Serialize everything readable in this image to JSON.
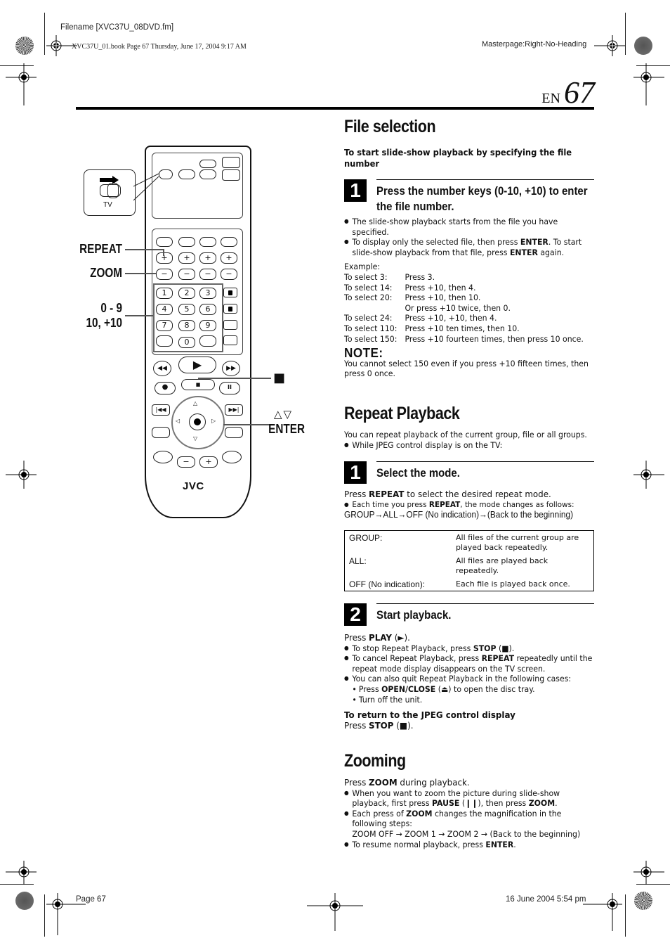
{
  "print_header": {
    "filename": "Filename [XVC37U_08DVD.fm]",
    "book_line": "XVC37U_01.book  Page 67  Thursday, June 17, 2004  9:17 AM",
    "masterpage": "Masterpage:Right-No-Heading"
  },
  "page_number": {
    "lang": "EN",
    "number": "67"
  },
  "remote_callouts": {
    "repeat": "REPEAT",
    "zoom": "ZOOM",
    "numbers_line1": "0 - 9",
    "numbers_line2": "10, +10",
    "stop_symbol": "■",
    "updown_symbol": "△▽",
    "enter": "ENTER",
    "tv_label": "TV",
    "brand": "JVC",
    "number_keys": [
      "1",
      "2",
      "3",
      "4",
      "5",
      "6",
      "7",
      "8",
      "9",
      "0"
    ]
  },
  "file_selection": {
    "title": "File selection",
    "lead": "To start slide-show playback by specifying the file number",
    "step1": {
      "number": "1",
      "title_line1": "Press the number keys (0-10, +10) to enter",
      "title_line2": "the file number."
    },
    "bullets": [
      {
        "pre": "The slide-show playback starts from the file you have specified.",
        "b1": "",
        "mid": "",
        "b2": "",
        "post": ""
      },
      {
        "pre": "To display only the selected file, then press ",
        "b1": "ENTER",
        "mid": ". To start slide-show playback from that file, press ",
        "b2": "ENTER",
        "post": " again."
      }
    ],
    "example_label": "Example:",
    "examples": [
      {
        "k": "To select 3:",
        "v": "Press 3."
      },
      {
        "k": "To select 14:",
        "v": "Press +10, then 4."
      },
      {
        "k": "To select 20:",
        "v": "Press +10, then 10."
      },
      {
        "k": "",
        "v": "Or press +10 twice, then 0."
      },
      {
        "k": "To select 24:",
        "v": "Press +10, +10, then 4."
      },
      {
        "k": "To select 110:",
        "v": "Press +10 ten times, then 10."
      },
      {
        "k": "To select 150:",
        "v": "Press +10 fourteen times, then press 10 once."
      }
    ],
    "note_heading": "NOTE:",
    "note_text": "You cannot select 150 even if you press +10 fifteen times, then press 0 once."
  },
  "repeat_playback": {
    "title": "Repeat Playback",
    "intro": "You can repeat playback of the current group, file or all groups.",
    "intro_bullet": "While JPEG control display is on the TV:",
    "step1": {
      "number": "1",
      "title": "Select the mode."
    },
    "press_pre": "Press ",
    "press_bold": "REPEAT",
    "press_post": " to select the desired repeat mode.",
    "each_pre": "Each time you press ",
    "each_bold": "REPEAT",
    "each_post": ", the mode changes as follows:",
    "sequence": "GROUP→ALL→OFF (No indication)→(Back to the beginning)",
    "modes": [
      {
        "mode": "GROUP:",
        "desc": "All files of the current group are played back repeatedly."
      },
      {
        "mode": "ALL:",
        "desc": "All files are played back repeatedly."
      },
      {
        "mode": "OFF (No indication):",
        "desc": "Each file is played back once."
      }
    ],
    "step2": {
      "number": "2",
      "title": "Start playback."
    },
    "play_pre": "Press ",
    "play_bold": "PLAY",
    "play_post": " (►).",
    "bullet_stop_pre": "To stop Repeat Playback, press ",
    "bullet_stop_bold": "STOP",
    "bullet_stop_post": " (■).",
    "bullet_cancel_pre": "To cancel Repeat Playback, press ",
    "bullet_cancel_bold": "REPEAT",
    "bullet_cancel_post": " repeatedly until the repeat mode display disappears on the TV screen.",
    "bullet_quit": "You can also quit Repeat Playback in the following cases:",
    "sub_open_pre": "Press ",
    "sub_open_bold": "OPEN/CLOSE",
    "sub_open_post": " (⏏) to open the disc tray.",
    "sub_off": "Turn off the unit.",
    "return_heading": "To return to the JPEG control display",
    "return_pre": "Press ",
    "return_bold": "STOP",
    "return_post": " (■)."
  },
  "zooming": {
    "title": "Zooming",
    "press_pre": "Press ",
    "press_bold": "ZOOM",
    "press_post": " during playback.",
    "b1_pre": "When you want to zoom the picture during slide-show playback, first press ",
    "b1_bold1": "PAUSE",
    "b1_mid": " (❙❙), then press ",
    "b1_bold2": "ZOOM",
    "b1_post": ".",
    "b2_pre": "Each press of ",
    "b2_bold": "ZOOM",
    "b2_post": " changes the magnification in the following steps:",
    "b2_sequence": "ZOOM OFF → ZOOM 1 → ZOOM 2 → (Back to the beginning)",
    "b3_pre": "To resume normal playback, press ",
    "b3_bold": "ENTER",
    "b3_post": "."
  },
  "print_footer": {
    "page": "Page 67",
    "date": "16 June 2004 5:54 pm"
  }
}
